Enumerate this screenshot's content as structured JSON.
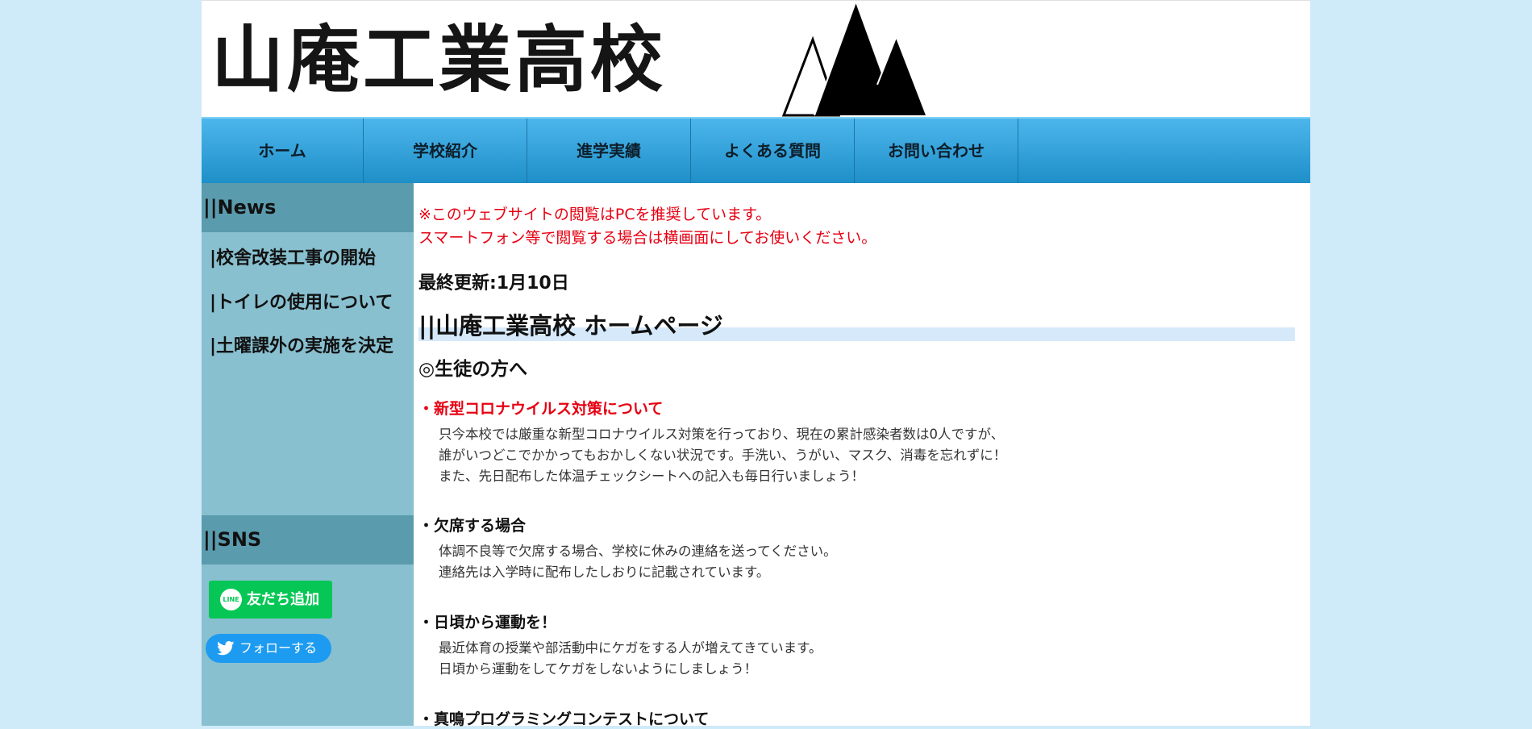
{
  "header": {
    "logo_text": "山庵工業高校"
  },
  "nav": {
    "items": [
      "ホーム",
      "学校紹介",
      "進学実績",
      "よくある質問",
      "お問い合わせ"
    ]
  },
  "sidebar": {
    "news_heading": "||News",
    "news_items": [
      "|校舎改装工事の開始",
      "|トイレの使用について",
      "|土曜課外の実施を決定"
    ],
    "sns_heading": "||SNS",
    "line_button_icon": "LINE",
    "line_button_label": "友だち追加",
    "twitter_button_label": "フォローする",
    "line_color": "#06c755",
    "twitter_color": "#1d9bf0"
  },
  "main": {
    "notice_line1": "※このウェブサイトの閲覧はPCを推奨しています。",
    "notice_line2": "スマートフォン等で閲覧する場合は横画面にしてお使いください。",
    "last_updated": "最終更新:1月10日",
    "page_title": "||山庵工業高校 ホームページ",
    "to_students": "◎生徒の方へ",
    "sections": [
      {
        "title": "・新型コロナウイルス対策について",
        "lines": [
          "只今本校では厳重な新型コロナウイルス対策を行っており、現在の累計感染者数は0人ですが、",
          "誰がいつどこでかかってもおかしくない状況です。手洗い、うがい、マスク、消毒を忘れずに！",
          "また、先日配布した体温チェックシートへの記入も毎日行いましょう！"
        ]
      },
      {
        "title": "・欠席する場合",
        "lines": [
          "体調不良等で欠席する場合、学校に休みの連絡を送ってください。",
          "連絡先は入学時に配布したしおりに記載されています。"
        ]
      },
      {
        "title": "・日頃から運動を！",
        "lines": [
          "最近体育の授業や部活動中にケガをする人が増えてきています。",
          "日頃から運動をしてケガをしないようにしましょう！"
        ]
      },
      {
        "title": "・真鳴プログラミングコンテストについて",
        "lines": []
      }
    ],
    "accent_red": "#e60012"
  }
}
